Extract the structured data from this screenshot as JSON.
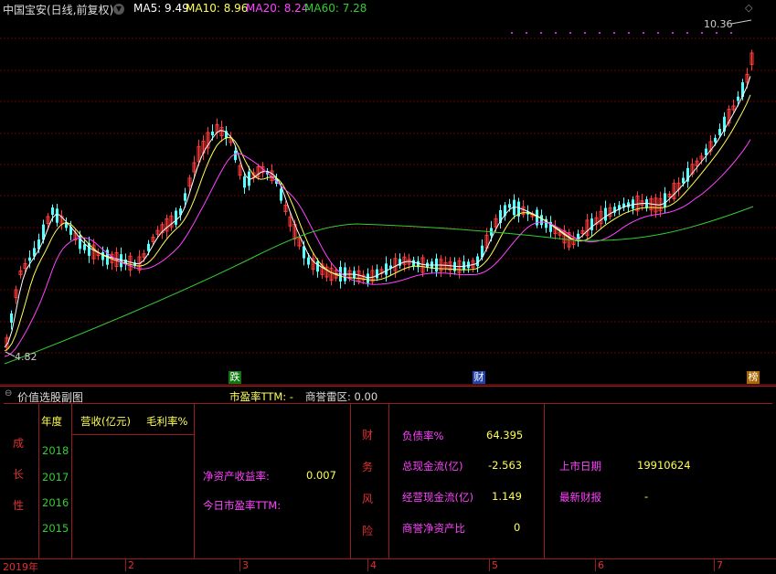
{
  "header": {
    "title": "中国宝安(日线,前复权)",
    "ma5": "MA5: 9.49",
    "ma10": "MA10: 8.96",
    "ma20": "MA20: 8.24",
    "ma60": "MA60: 7.28"
  },
  "chart": {
    "high_label": "10.36",
    "low_label": "4.82",
    "markers": [
      "跌",
      "财",
      "榜"
    ],
    "colors": {
      "up": "#ff3b3b",
      "down": "#54ffff",
      "ma5": "#ffffff",
      "ma10": "#ffff55",
      "ma20": "#ff44ff",
      "ma60": "#33cc33",
      "grid": "#6b0000"
    }
  },
  "chart_data": {
    "type": "candlestick",
    "ylim": [
      4.82,
      10.36
    ],
    "ma_series": [
      {
        "name": "MA5",
        "value": 9.49
      },
      {
        "name": "MA10",
        "value": 8.96
      },
      {
        "name": "MA20",
        "value": 8.24
      },
      {
        "name": "MA60",
        "value": 7.28
      }
    ],
    "x_tick_labels": [
      "2019年",
      "2",
      "3",
      "4",
      "5",
      "6",
      "7"
    ]
  },
  "panel": {
    "title": "价值选股副图",
    "pe_ttm": "市盈率TTM: -",
    "goodwill_zone": "商誉雷区: 0.00",
    "growth_label": [
      "成",
      "长",
      "性"
    ],
    "year_header": "年度",
    "revenue_header": "营收(亿元)",
    "margin_header": "毛利率%",
    "years": [
      "2018",
      "2017",
      "2016",
      "2015"
    ],
    "roe_label": "净资产收益率:",
    "roe_value": "0.007",
    "today_pe_label": "今日市盈率TTM:",
    "risk_label": [
      "财",
      "务",
      "风",
      "险"
    ],
    "debt_ratio_label": "负债率%",
    "debt_ratio_value": "64.395",
    "total_cash_label": "总现金流(亿)",
    "total_cash_value": "-2.563",
    "op_cash_label": "经营现金流(亿)",
    "op_cash_value": "1.149",
    "goodwill_ratio_label": "商誉净资产比",
    "goodwill_ratio_value": "0",
    "listing_label": "上市日期",
    "listing_value": "19910624",
    "latest_report_label": "最新财报",
    "latest_report_value": "-"
  },
  "axis": {
    "labels": [
      "2019年",
      "2",
      "3",
      "4",
      "5",
      "6",
      "7"
    ]
  }
}
